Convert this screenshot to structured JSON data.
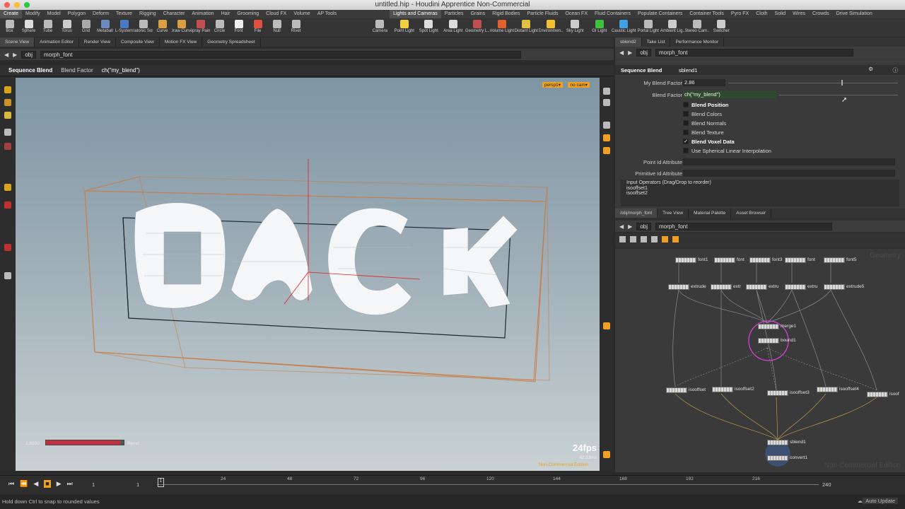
{
  "window": {
    "title": "untitled.hip - Houdini Apprentice Non-Commercial"
  },
  "shelf_tabs_left": [
    "Create",
    "Modify",
    "Model",
    "Polygon",
    "Deform",
    "Texture",
    "Rigging",
    "Character",
    "Animation",
    "Hair",
    "Grooming",
    "Cloud FX",
    "Volume",
    "AP Tools"
  ],
  "shelf_tabs_right": [
    "Lights and Cameras",
    "Particles",
    "Grains",
    "Rigid Bodies",
    "Particle Fluids",
    "Ocean FX",
    "Fluid Containers",
    "Populate Containers",
    "Container Tools",
    "Pyro FX",
    "Cloth",
    "Solid",
    "Wires",
    "Crowds",
    "Drive Simulation"
  ],
  "tools_left": [
    "Box",
    "Sphere",
    "Tube",
    "Torus",
    "Grid",
    "Metaball",
    "L-System",
    "Platonic Sol..",
    "Curve",
    "Draw Curve",
    "Spray Paint",
    "Circle",
    "Font",
    "File",
    "Null",
    "Rivet"
  ],
  "tools_right": [
    "Camera",
    "Point Light",
    "Spot Light",
    "Area Light",
    "Geometry L..",
    "Volume Light",
    "Distant Light",
    "Environmen..",
    "Sky Light",
    "GI Light",
    "Caustic Light",
    "Portal Light",
    "Ambient Lig..",
    "Stereo Cam..",
    "Switcher"
  ],
  "pane_tabs_left": [
    "Scene View",
    "Animation Editor",
    "Render View",
    "Composite View",
    "Motion FX View",
    "Geometry Spreadsheet"
  ],
  "pane_tabs_right": [
    "sblend2",
    "Take List",
    "Performance Monitor"
  ],
  "path_left": {
    "root": "obj",
    "node": "morph_font"
  },
  "operation": {
    "name": "Sequence Blend",
    "parm": "Blend Factor",
    "expr": "ch(\"my_blend\")"
  },
  "viewport": {
    "persp": "persp1▾",
    "cam": "no cam▾",
    "fps": "24fps",
    "ms": "42.33ms",
    "watermark": "Non-Commercial Edition",
    "slider_value": "2.8600",
    "slider_label": "Blend",
    "slider_fraction": 0.95
  },
  "params": {
    "node_type": "Sequence Blend",
    "node_name": "sblend1",
    "my_blend_label": "My Blend Factor",
    "my_blend_value": "2.86",
    "blend_factor_label": "Blend Factor",
    "blend_factor_value": "ch(\"my_blend\")",
    "checkboxes": [
      {
        "label": "Blend Position",
        "checked": false
      },
      {
        "label": "Blend Colors",
        "checked": false
      },
      {
        "label": "Blend Normals",
        "checked": false
      },
      {
        "label": "Blend Texture",
        "checked": false
      },
      {
        "label": "Blend Voxel Data",
        "checked": true
      },
      {
        "label": "Use Spherical Linear Interpolation",
        "checked": false
      }
    ],
    "point_id_label": "Point Id Attribute",
    "prim_id_label": "Primitive Id Attribute",
    "input_ops_label": "Input Operators (Drag/Drop to reorder)",
    "input_ops": [
      "isooffset1",
      "isooffset2"
    ]
  },
  "net_tabs": [
    "/obj/morph_font",
    "Tree View",
    "Material Palette",
    "Asset Browser"
  ],
  "net_path": {
    "root": "obj",
    "node": "morph_font"
  },
  "net_watermark_top": "Geometry",
  "net_watermark_bottom": "Non-Commercial Edition",
  "nodes": {
    "font1": "font1",
    "font2": "font",
    "font3": "font3",
    "font4": "font",
    "font5": "font5",
    "extrude1": "extrude",
    "extrude2": "extr",
    "extrude3": "extru",
    "extrude4": "extru",
    "extrude5": "extrude5",
    "merge1": "merge1",
    "bound1": "bound1",
    "iso1": "isooffset",
    "iso2": "isooffset2",
    "iso3": "isooffset3",
    "iso4": "isooffset4",
    "iso5": "isoof",
    "sblend1": "sblend1",
    "convert1": "convert1"
  },
  "timeline": {
    "current_frame": "1",
    "start": "1",
    "end": "240",
    "ticks": [
      "24",
      "48",
      "72",
      "96",
      "120",
      "144",
      "168",
      "192",
      "216"
    ],
    "auto_update": "Auto Update"
  },
  "status": {
    "message": "Hold down Ctrl to snap to rounded values"
  },
  "colors": {
    "accent": "#f0a020",
    "selected": "#e040e0",
    "boundbox": "#c87e4a",
    "axis_red": "#e02020"
  }
}
